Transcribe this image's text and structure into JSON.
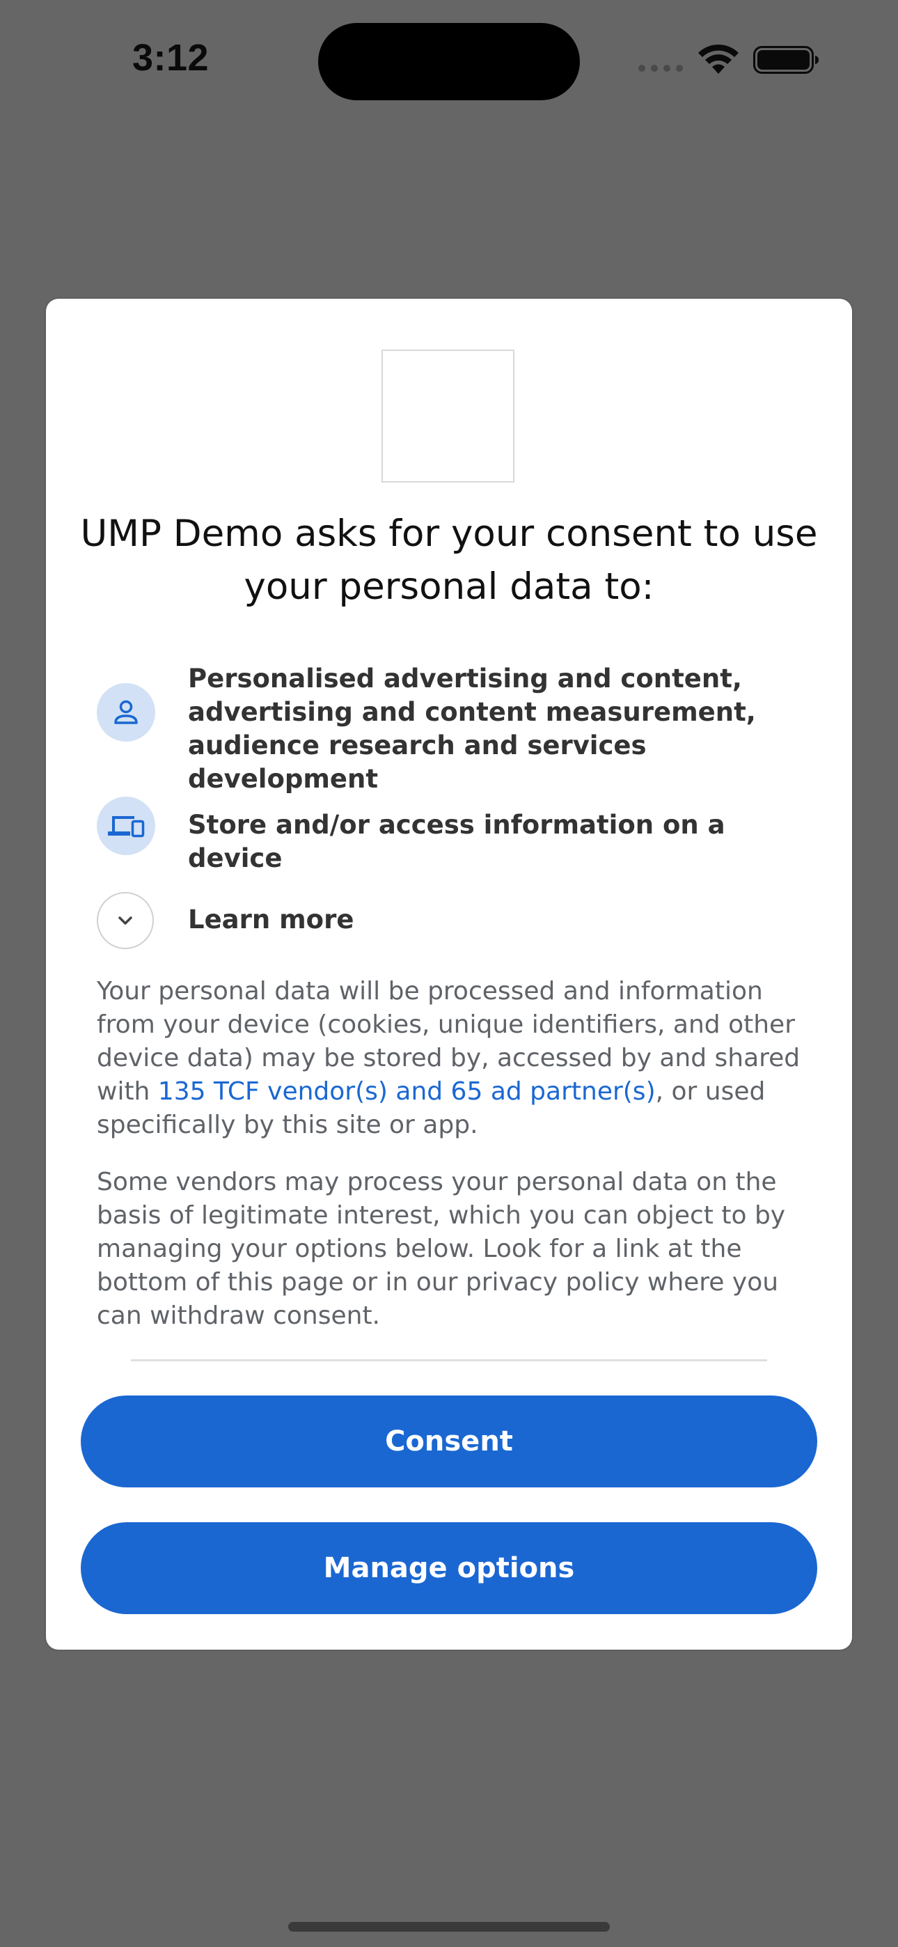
{
  "status_bar": {
    "time": "3:12"
  },
  "dialog": {
    "title_line1": "UMP Demo asks for your consent to use",
    "title_line2": "your personal data to:",
    "purposes": [
      {
        "icon": "person-icon",
        "text": "Personalised advertising and content, advertising and content measurement, audience research and services development"
      },
      {
        "icon": "devices-icon",
        "text": "Store and/or access information on a device"
      }
    ],
    "learn_more_label": "Learn more",
    "paragraph1": {
      "before_link": "Your personal data will be processed and information from your device (cookies, unique identifiers, and other device data) may be stored by, accessed by and shared with ",
      "link": "135 TCF vendor(s) and 65 ad partner(s)",
      "after_link": ", or used specifically by this site or app."
    },
    "paragraph2": "Some vendors may process your personal data on the basis of legitimate interest, which you can object to by managing your options below. Look for a link at the bottom of this page or in our privacy policy where you can withdraw consent.",
    "consent_button": "Consent",
    "manage_button": "Manage options"
  },
  "colors": {
    "backdrop": "#666666",
    "accent": "#1a67d2",
    "icon_bg": "#d2e1f5"
  }
}
